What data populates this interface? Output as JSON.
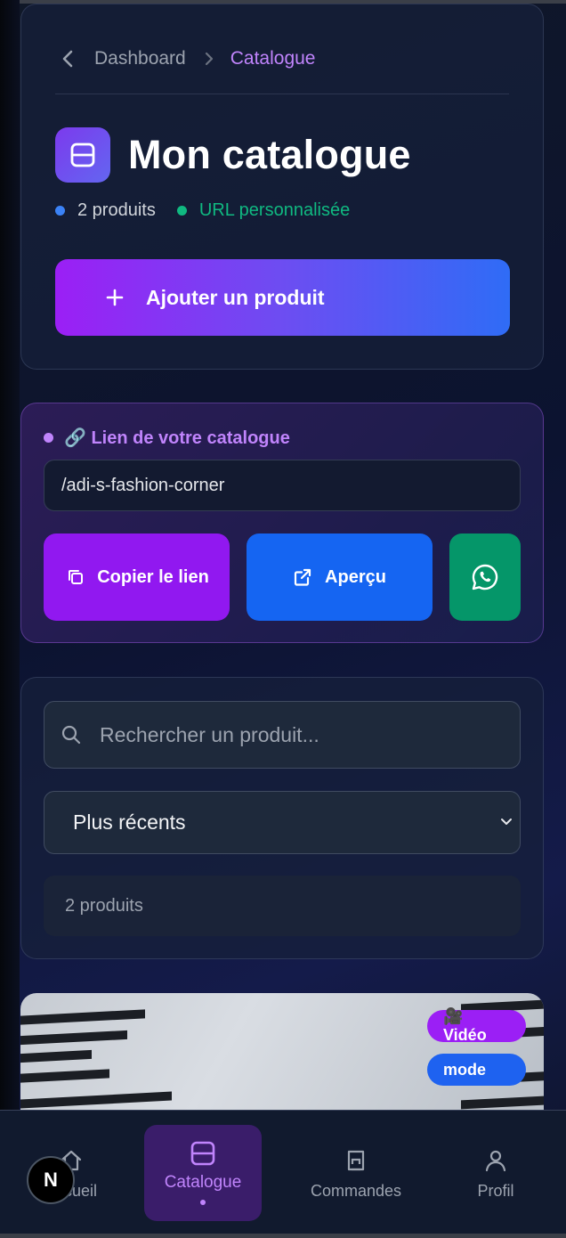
{
  "breadcrumb": {
    "parent": "Dashboard",
    "current": "Catalogue"
  },
  "header": {
    "title": "Mon catalogue",
    "product_count": "2 produits",
    "url_status": "URL personnalisée",
    "add_button": "Ajouter un produit"
  },
  "catalog_link": {
    "label": "🔗 Lien de votre catalogue",
    "url": "/adi-s-fashion-corner",
    "copy_button": "Copier le lien",
    "preview_button": "Aperçu"
  },
  "filters": {
    "search_placeholder": "Rechercher un produit...",
    "sort_selected": "Plus récents",
    "result_count": "2 produits"
  },
  "product": {
    "badges": [
      "🎥 Vidéo",
      "mode"
    ]
  },
  "bottom_nav": {
    "items": [
      {
        "label": "Accueil",
        "icon": "home-icon"
      },
      {
        "label": "Catalogue",
        "icon": "catalogue-icon",
        "active": true
      },
      {
        "label": "Commandes",
        "icon": "orders-icon"
      },
      {
        "label": "Profil",
        "icon": "profile-icon"
      }
    ]
  },
  "dev_badge": "N",
  "colors": {
    "accent_purple": "#9b1ff5",
    "accent_blue": "#1565f2",
    "success_green": "#10b981",
    "whatsapp_green": "#059669"
  }
}
